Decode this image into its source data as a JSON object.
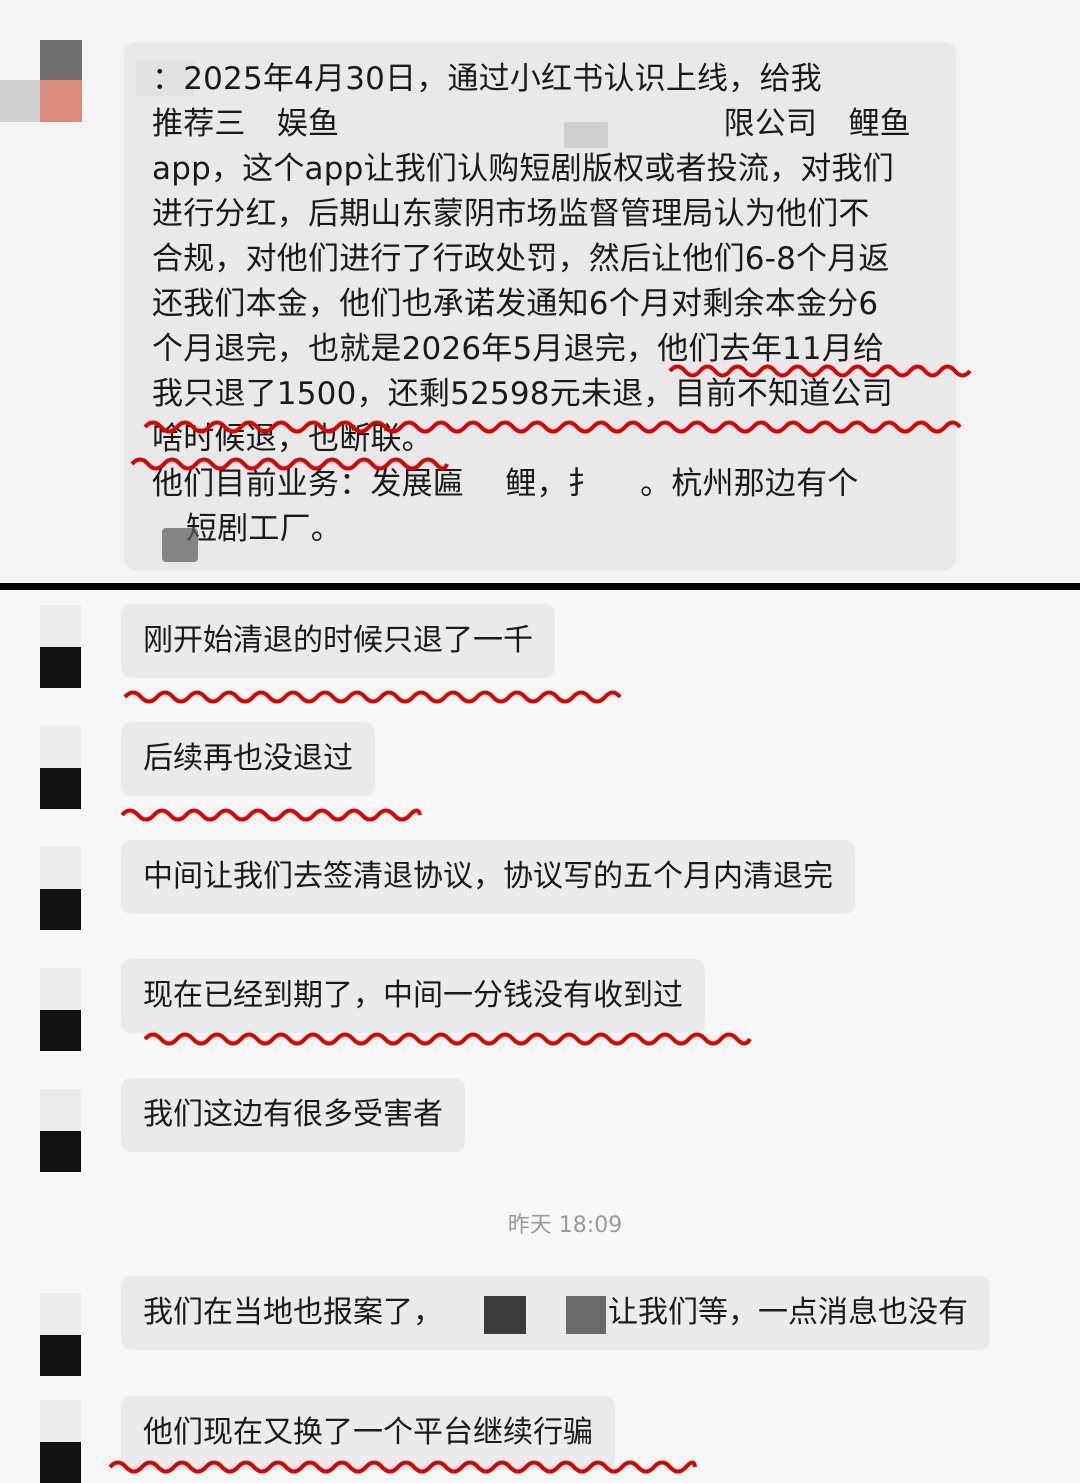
{
  "top_message": {
    "lines": [
      "：2025年4月30日，通过小红书认识上线，给我",
      "推荐三　娱鱼　　　　　　　　　　　　 限公司　鲤鱼",
      "app，这个app让我们认购短剧版权或者投流，对我们",
      "进行分红，后期山东蒙阴市场监督管理局认为他们不",
      "合规，对他们进行了行政处罚，然后让他们6-8个月返",
      "还我们本金，他们也承诺发通知6个月对剩余本金分6",
      "个月退完，也就是2026年5月退完，他们去年11月给",
      "我只退了1500，还剩52598元未退，目前不知道公司",
      "啥时候退，也断联。",
      "他们目前业务：发展匾　 鲤，扌　 。杭州那边有个",
      "短剧工厂。"
    ]
  },
  "messages": [
    {
      "text": "刚开始清退的时候只退了一千"
    },
    {
      "text": "后续再也没退过"
    },
    {
      "text": "中间让我们去签清退协议，协议写的五个月内清退完"
    },
    {
      "text": "现在已经到期了，中间一分钱没有收到过"
    },
    {
      "text": "我们这边有很多受害者"
    },
    {
      "text": "我们在当地也报案了，　　　　　　让我们等，一点消息也没有"
    },
    {
      "text": "他们现在又换了一个平台继续行骗"
    }
  ],
  "timestamp": "昨天 18:09",
  "colors": {
    "annotation": "#e00000",
    "bubble": "#ebebeb",
    "background": "#f7f7f7"
  }
}
